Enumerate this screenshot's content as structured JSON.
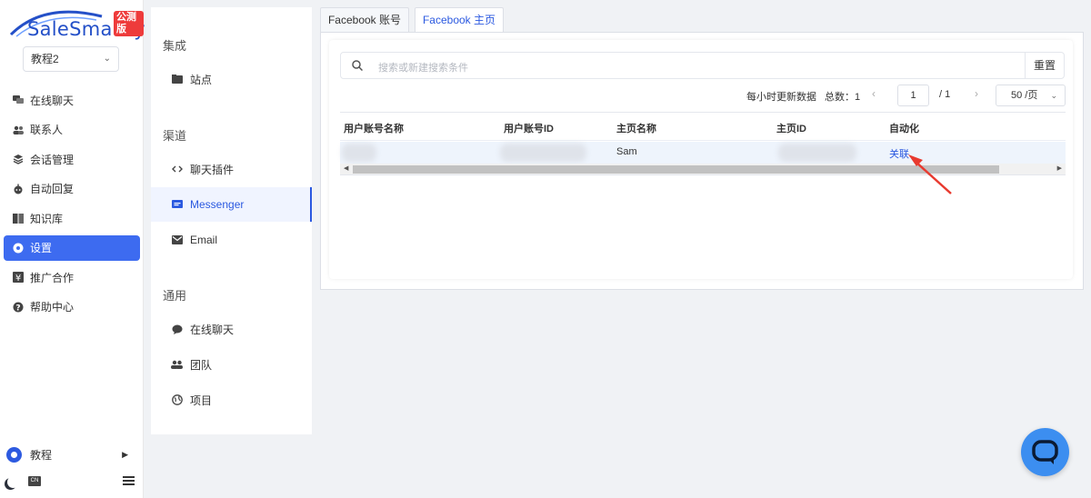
{
  "brand": {
    "name": "SaleSmartly",
    "badge": "公测版",
    "accent": "#3d6bf0"
  },
  "workspace": {
    "selected": "教程2"
  },
  "sidebar": {
    "items": [
      {
        "label": "在线聊天",
        "icon": "chat-icon"
      },
      {
        "label": "联系人",
        "icon": "contacts-icon"
      },
      {
        "label": "会话管理",
        "icon": "layers-icon"
      },
      {
        "label": "自动回复",
        "icon": "robot-icon"
      },
      {
        "label": "知识库",
        "icon": "book-icon"
      },
      {
        "label": "设置",
        "icon": "settings-icon",
        "active": true
      },
      {
        "label": "推广合作",
        "icon": "yen-icon"
      },
      {
        "label": "帮助中心",
        "icon": "help-icon"
      }
    ],
    "user": "教程",
    "lang_tag": "CN"
  },
  "settings_nav": {
    "sections": [
      {
        "title": "集成",
        "items": [
          {
            "label": "站点",
            "icon": "folder-icon"
          }
        ]
      },
      {
        "title": "渠道",
        "items": [
          {
            "label": "聊天插件",
            "icon": "code-icon"
          },
          {
            "label": "Messenger",
            "icon": "message-square-icon",
            "active": true
          },
          {
            "label": "Email",
            "icon": "mail-icon"
          }
        ]
      },
      {
        "title": "通用",
        "items": [
          {
            "label": "在线聊天",
            "icon": "chat-bubble-icon"
          },
          {
            "label": "团队",
            "icon": "team-icon"
          },
          {
            "label": "项目",
            "icon": "globe-icon"
          }
        ]
      }
    ]
  },
  "tabs": [
    {
      "label": "Facebook 账号",
      "active": false
    },
    {
      "label": "Facebook 主页",
      "active": true
    }
  ],
  "search": {
    "placeholder": "搜索或新建搜索条件",
    "reset_label": "重置"
  },
  "pager": {
    "update_note": "每小时更新数据",
    "total_label": "总数：1",
    "current_page": "1",
    "page_total": "/ 1",
    "page_size": "50 /页"
  },
  "table": {
    "columns": [
      "用户账号名称",
      "用户账号ID",
      "主页名称",
      "主页ID",
      "自动化"
    ],
    "rows": [
      {
        "user_name": "",
        "user_id": "",
        "page_name": "Sam",
        "page_id": "",
        "automation": "关联"
      }
    ]
  },
  "colors": {
    "link": "#2b59e0",
    "annotation_arrow": "#e83a2f",
    "chat_fab": "#3c8ef0"
  }
}
